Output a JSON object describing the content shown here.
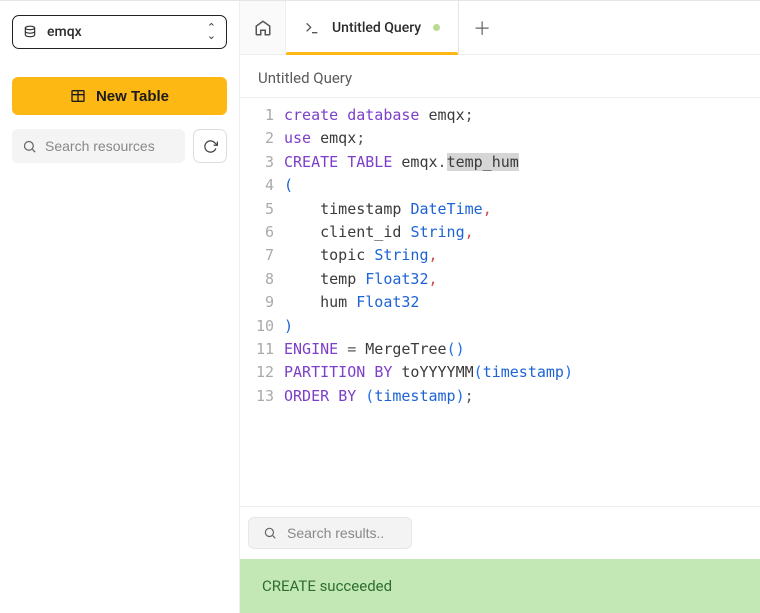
{
  "sidebar": {
    "database": "emqx",
    "new_table_label": "New Table",
    "search_placeholder": "Search resources"
  },
  "tabs": {
    "active": {
      "title": "Untitled Query"
    }
  },
  "breadcrumb": "Untitled Query",
  "editor": {
    "lines": [
      [
        {
          "t": "create ",
          "c": "kw"
        },
        {
          "t": "database ",
          "c": "kw"
        },
        {
          "t": "emqx",
          "c": "ident"
        },
        {
          "t": ";",
          "c": "punc"
        }
      ],
      [
        {
          "t": "use ",
          "c": "kw"
        },
        {
          "t": "emqx",
          "c": "ident"
        },
        {
          "t": ";",
          "c": "punc"
        }
      ],
      [
        {
          "t": "CREATE ",
          "c": "kw"
        },
        {
          "t": "TABLE ",
          "c": "kw"
        },
        {
          "t": "emqx",
          "c": "ident"
        },
        {
          "t": ".",
          "c": "punc"
        },
        {
          "t": "temp_hum",
          "c": "ident sel"
        }
      ],
      [
        {
          "t": "(",
          "c": "struct"
        }
      ],
      [
        {
          "t": "    timestamp ",
          "c": "ident"
        },
        {
          "t": "DateTime",
          "c": "typ"
        },
        {
          "t": ",",
          "c": "comma"
        }
      ],
      [
        {
          "t": "    client_id ",
          "c": "ident"
        },
        {
          "t": "String",
          "c": "typ"
        },
        {
          "t": ",",
          "c": "comma"
        }
      ],
      [
        {
          "t": "    topic ",
          "c": "ident"
        },
        {
          "t": "String",
          "c": "typ"
        },
        {
          "t": ",",
          "c": "comma"
        }
      ],
      [
        {
          "t": "    temp ",
          "c": "ident"
        },
        {
          "t": "Float32",
          "c": "typ"
        },
        {
          "t": ",",
          "c": "comma"
        }
      ],
      [
        {
          "t": "    hum ",
          "c": "ident"
        },
        {
          "t": "Float32",
          "c": "typ"
        }
      ],
      [
        {
          "t": ")",
          "c": "struct"
        }
      ],
      [
        {
          "t": "ENGINE ",
          "c": "kw"
        },
        {
          "t": "= ",
          "c": "punc"
        },
        {
          "t": "MergeTree",
          "c": "ident"
        },
        {
          "t": "()",
          "c": "paren"
        }
      ],
      [
        {
          "t": "PARTITION ",
          "c": "kw"
        },
        {
          "t": "BY ",
          "c": "kw"
        },
        {
          "t": "toYYYYMM",
          "c": "ident"
        },
        {
          "t": "(",
          "c": "paren"
        },
        {
          "t": "timestamp",
          "c": "fn-id"
        },
        {
          "t": ")",
          "c": "paren"
        }
      ],
      [
        {
          "t": "ORDER ",
          "c": "kw"
        },
        {
          "t": "BY ",
          "c": "kw"
        },
        {
          "t": "(",
          "c": "paren"
        },
        {
          "t": "timestamp",
          "c": "fn-id"
        },
        {
          "t": ")",
          "c": "paren"
        },
        {
          "t": ";",
          "c": "punc"
        }
      ]
    ]
  },
  "results": {
    "search_placeholder": "Search results.."
  },
  "status_message": "CREATE succeeded"
}
